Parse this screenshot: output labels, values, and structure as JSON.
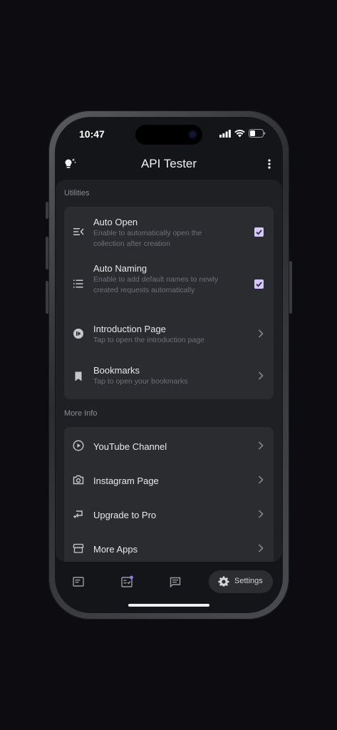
{
  "status": {
    "time": "10:47"
  },
  "header": {
    "title": "API Tester"
  },
  "utilities": {
    "label": "Utilities",
    "items": [
      {
        "title": "Auto Open",
        "subtitle": "Enable to automatically open the collection after creation",
        "checked": true,
        "icon": "auto-open-icon"
      },
      {
        "title": "Auto Naming",
        "subtitle": "Enable to add default names to newly created requests automatically",
        "checked": true,
        "icon": "list-numbered-icon"
      },
      {
        "title": "Introduction Page",
        "subtitle": "Tap to open the introduction page",
        "icon": "play-circle-icon"
      },
      {
        "title": "Bookmarks",
        "subtitle": "Tap to open your bookmarks",
        "icon": "bookmark-icon"
      }
    ]
  },
  "more_info": {
    "label": "More Info",
    "items": [
      {
        "title": "YouTube Channel",
        "icon": "play-outline-icon"
      },
      {
        "title": "Instagram Page",
        "icon": "camera-icon"
      },
      {
        "title": "Upgrade to Pro",
        "icon": "upgrade-icon"
      },
      {
        "title": "More Apps",
        "icon": "store-icon"
      }
    ]
  },
  "bottom_nav": {
    "settings_label": "Settings"
  },
  "colors": {
    "accent_check": "#d5c6ff",
    "card": "#2a2c30",
    "panel": "#1f2024"
  }
}
